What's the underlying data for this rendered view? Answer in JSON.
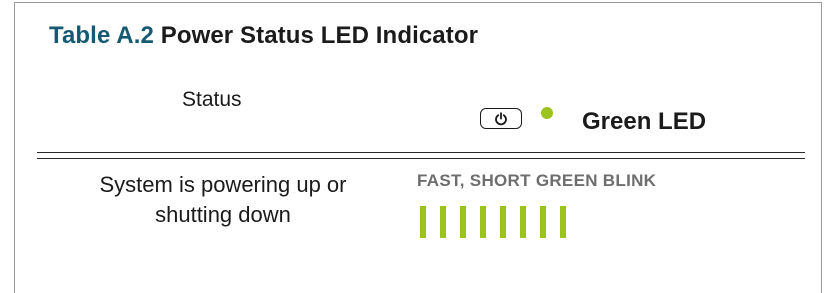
{
  "table": {
    "number": "Table A.2",
    "title": "Power Status LED Indicator"
  },
  "header": {
    "status_label": "Status",
    "led_label": "Green LED",
    "icons": [
      "power-button-icon",
      "green-led-dot-icon"
    ]
  },
  "rows": [
    {
      "status_line1": "System is powering up or",
      "status_line2": "shutting down",
      "blink_label": "FAST, SHORT GREEN BLINK",
      "blink_count": 8
    }
  ],
  "colors": {
    "title_accent": "#155a72",
    "led_green": "#9ac31c",
    "blink_label_gray": "#6e6e6e"
  }
}
